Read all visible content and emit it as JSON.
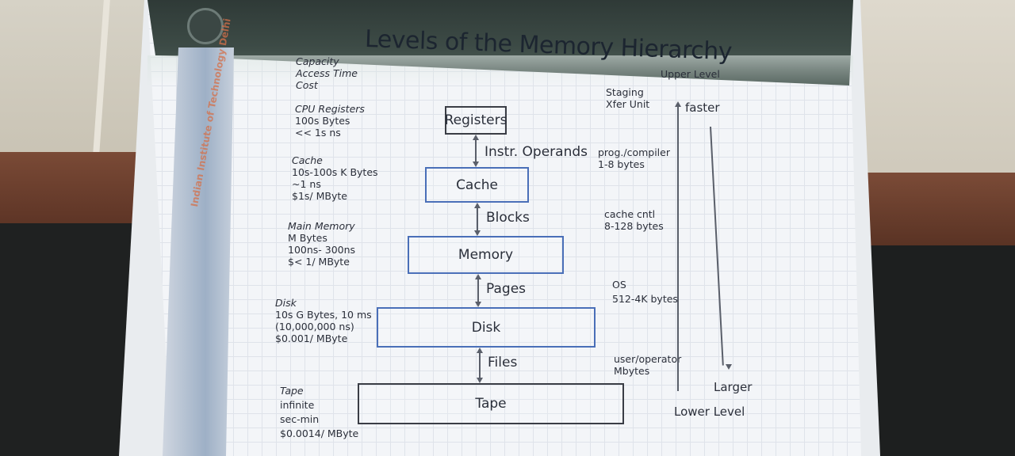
{
  "slide": {
    "title": "Levels of the Memory Hierarchy",
    "institute": "Indian Institute of Technology Delhi",
    "left_header": [
      "Capacity",
      "Access Time",
      "Cost"
    ],
    "upper_level": "Upper Level",
    "staging": [
      "Staging",
      "Xfer Unit"
    ],
    "faster": "faster",
    "larger": "Larger",
    "lower_level": "Lower Level",
    "levels": [
      {
        "specs": [
          "CPU Registers",
          "100s Bytes",
          "<< 1s ns"
        ],
        "block": "Registers"
      },
      {
        "specs": [
          "Cache",
          "10s-100s K Bytes",
          "~1 ns",
          "$1s/ MByte"
        ],
        "block": "Cache"
      },
      {
        "specs": [
          "Main Memory",
          "M Bytes",
          "100ns- 300ns",
          "$< 1/ MByte"
        ],
        "block": "Memory"
      },
      {
        "specs": [
          "Disk",
          "10s G Bytes, 10 ms",
          "(10,000,000 ns)",
          "$0.001/ MByte"
        ],
        "block": "Disk"
      },
      {
        "specs": [
          "Tape",
          "infinite",
          "sec-min",
          "$0.0014/ MByte"
        ],
        "block": "Tape"
      }
    ],
    "transfers": [
      {
        "label": "Instr. Operands",
        "agent": [
          "prog./compiler",
          "1-8 bytes"
        ]
      },
      {
        "label": "Blocks",
        "agent": [
          "cache cntl",
          "8-128 bytes"
        ]
      },
      {
        "label": "Pages",
        "agent": [
          "OS",
          "512-4K bytes"
        ]
      },
      {
        "label": "Files",
        "agent": [
          "user/operator",
          "Mbytes"
        ]
      }
    ]
  }
}
